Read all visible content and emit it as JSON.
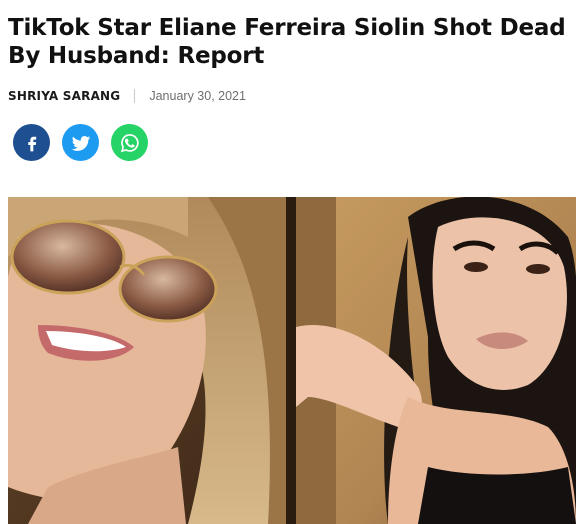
{
  "article": {
    "headline": "TikTok Star Eliane Ferreira Siolin Shot Dead By Husband: Report",
    "author": "SHRIYA SARANG",
    "date": "January 30, 2021"
  },
  "share": [
    {
      "name": "facebook",
      "icon": "facebook-icon",
      "color": "#1d4f91"
    },
    {
      "name": "twitter",
      "icon": "twitter-icon",
      "color": "#1d9bf0"
    },
    {
      "name": "whatsapp",
      "icon": "whatsapp-icon",
      "color": "#25d366"
    }
  ]
}
